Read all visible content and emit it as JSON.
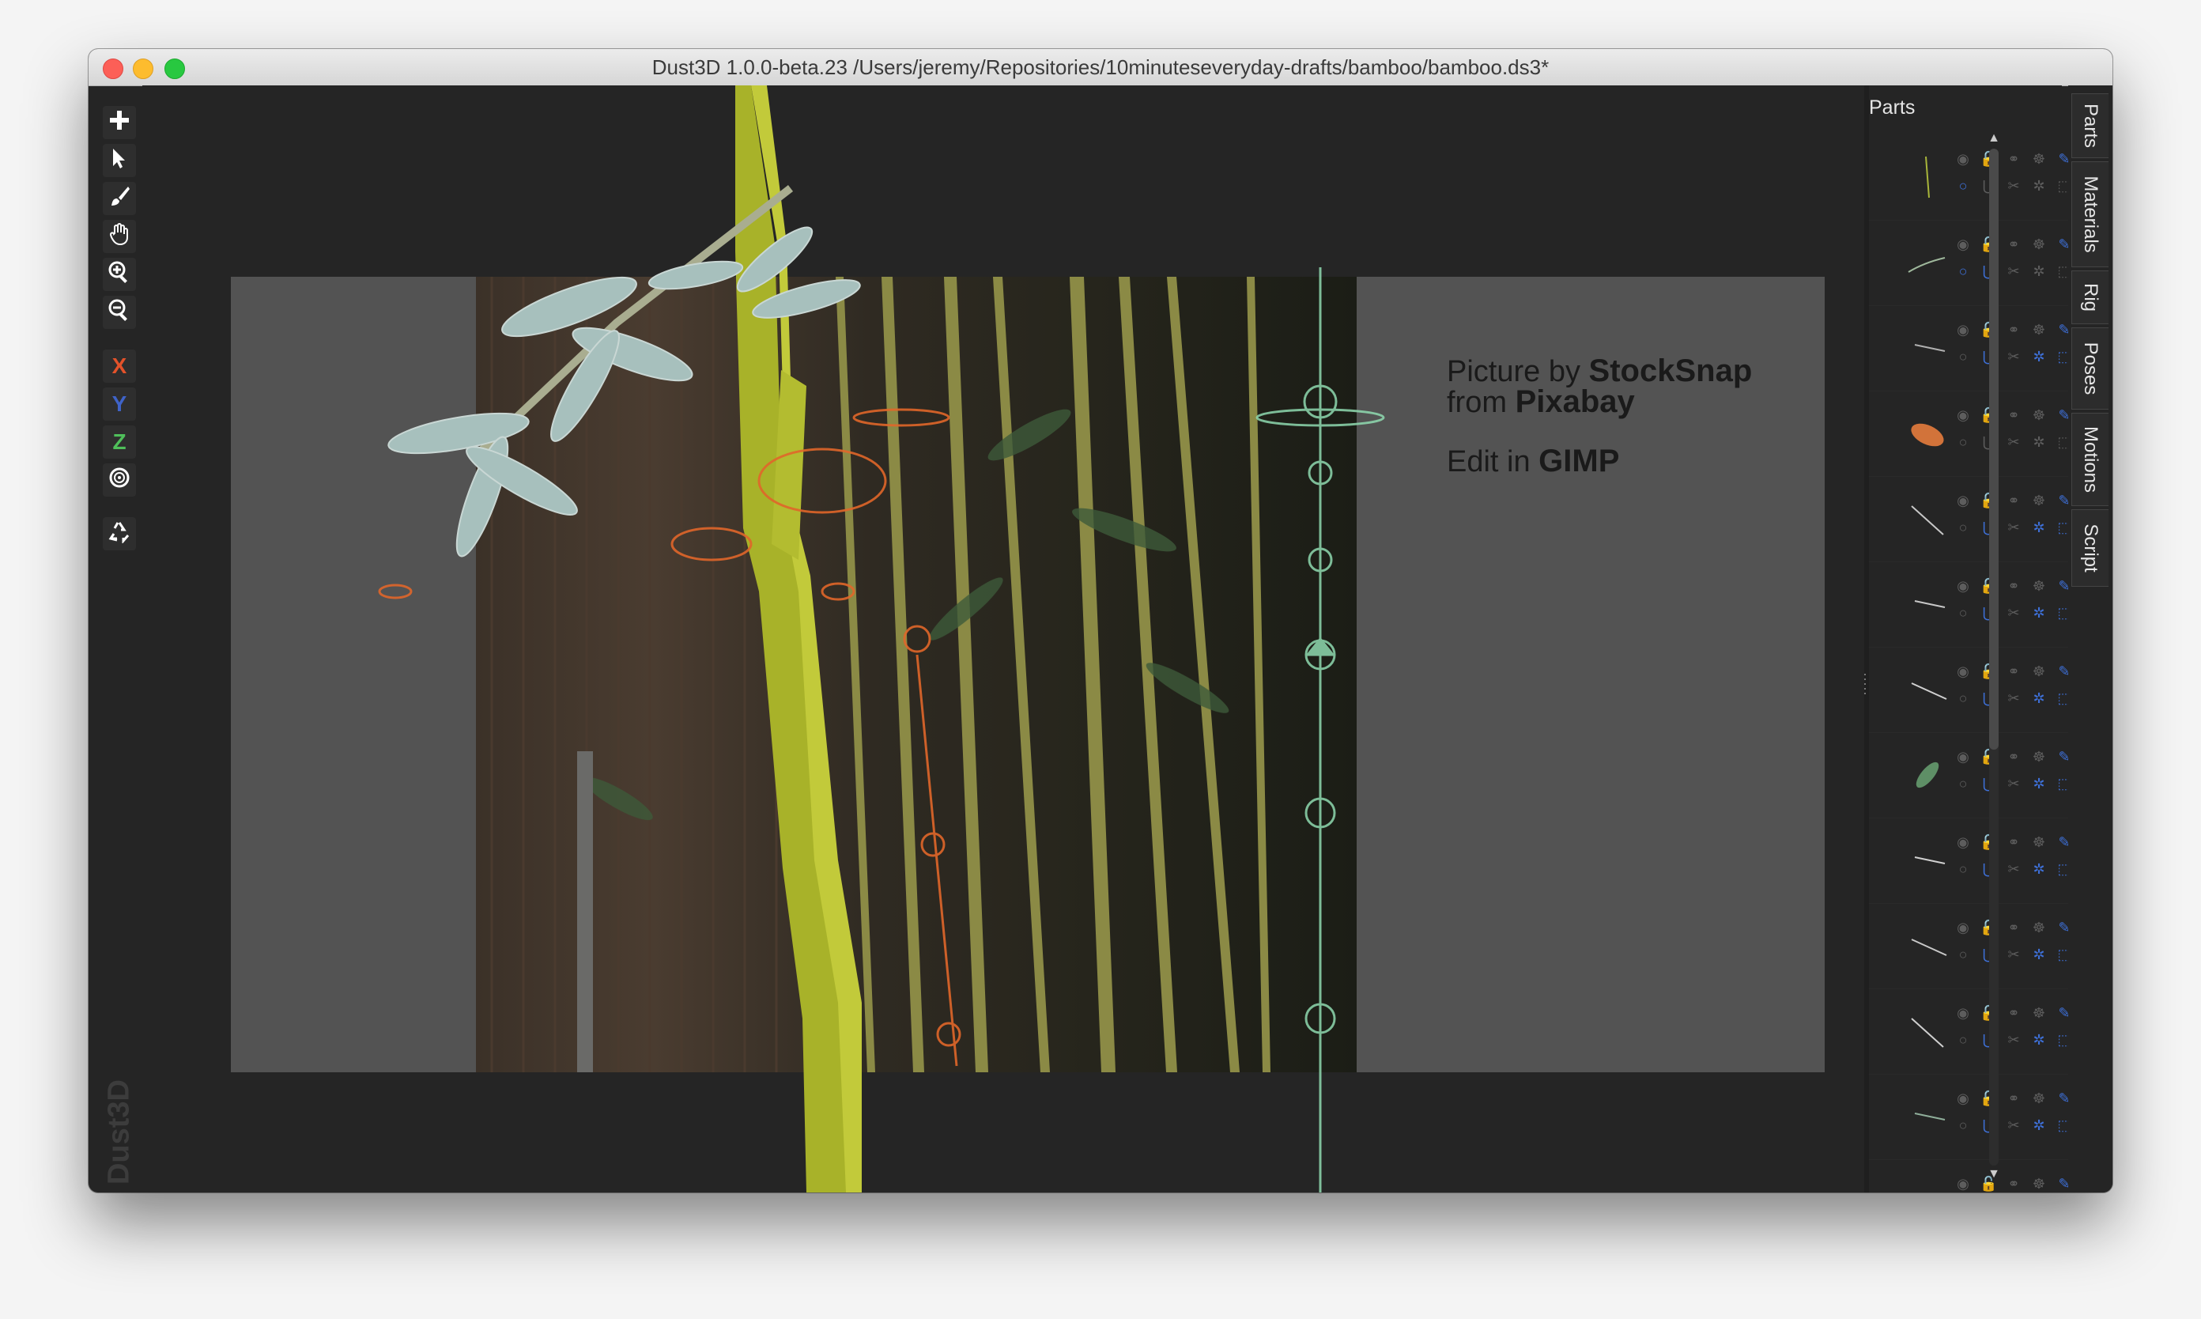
{
  "window": {
    "title": "Dust3D 1.0.0-beta.23 /Users/jeremy/Repositories/10minuteseveryday-drafts/bamboo/bamboo.ds3*"
  },
  "toolbar": {
    "tools": [
      {
        "name": "add-tool",
        "icon": "plus-icon"
      },
      {
        "name": "select-tool",
        "icon": "arrow-pointer-icon"
      },
      {
        "name": "paint-tool",
        "icon": "brush-icon"
      },
      {
        "name": "drag-tool",
        "icon": "hand-icon"
      },
      {
        "name": "zoom-in-tool",
        "icon": "zoom-in-icon"
      },
      {
        "name": "zoom-out-tool",
        "icon": "zoom-out-icon"
      }
    ],
    "axis_x": "X",
    "axis_y": "Y",
    "axis_z": "Z",
    "axis_x_color": "#e3522a",
    "axis_y_color": "#3f63c8",
    "axis_z_color": "#4fbf5a",
    "radial_icon": "radial-target-icon",
    "regenerate_icon": "recycle-icon"
  },
  "watermark": "Dust3D",
  "reference_image": {
    "line1_prefix": "Picture by ",
    "line1_bold": "StockSnap",
    "line2_prefix": "from ",
    "line2_bold": "Pixabay",
    "line3_prefix": "Edit in ",
    "line3_bold": "GIMP"
  },
  "parts_panel": {
    "title": "Parts",
    "float_icon": "float-window-icon",
    "close_icon": "close-icon",
    "accent_color": "#3e70d8",
    "rows": [
      {
        "thumb": "stalk-segment",
        "color": "#a8b53a"
      },
      {
        "thumb": "branch",
        "color": "#9fb89c"
      },
      {
        "thumb": "leaf-stem",
        "color": "#b0b0b0"
      },
      {
        "thumb": "node-cap",
        "color": "#d2733a"
      },
      {
        "thumb": "leaf-stem",
        "color": "#c8c8c8"
      },
      {
        "thumb": "leaf-stem",
        "color": "#c8c8c8"
      },
      {
        "thumb": "leaf-stem",
        "color": "#d0d0d0"
      },
      {
        "thumb": "leaf",
        "color": "#5e8f66"
      },
      {
        "thumb": "leaf-stem",
        "color": "#d0d0d0"
      },
      {
        "thumb": "leaf-stem",
        "color": "#c8c8c8"
      },
      {
        "thumb": "leaf-stem",
        "color": "#d0d0d0"
      },
      {
        "thumb": "leaf-stem",
        "color": "#8fae9a"
      },
      {
        "thumb": "leaf-stem",
        "color": "#c8c8c8"
      }
    ]
  },
  "dock_tabs": [
    "Parts",
    "Materials",
    "Rig",
    "Poses",
    "Motions",
    "Script"
  ]
}
